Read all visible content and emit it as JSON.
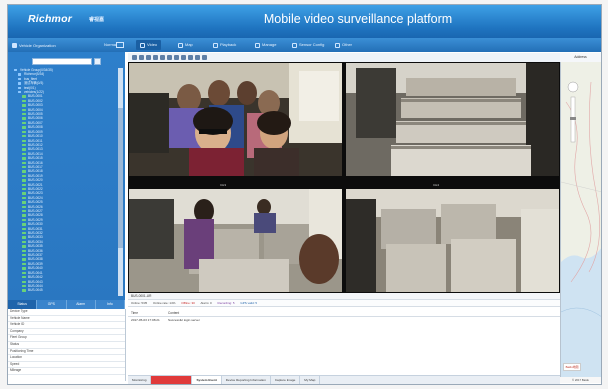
{
  "header": {
    "brand": "Richmor",
    "brand_suffix": "睿视嘉",
    "title": "Mobile video surveillance platform"
  },
  "toolbar": {
    "sidebar_label": "Vehicle Organization",
    "sidebar_mode": "Normal",
    "tabs": [
      {
        "label": "Video",
        "icon": "video-icon"
      },
      {
        "label": "Map",
        "icon": "map-icon"
      },
      {
        "label": "Playback",
        "icon": "playback-icon"
      },
      {
        "label": "Manage",
        "icon": "manage-icon"
      },
      {
        "label": "Sensor Config",
        "icon": "config-icon"
      },
      {
        "label": "Other",
        "icon": "other-icon"
      }
    ]
  },
  "sidebar": {
    "search": {
      "placeholder": "",
      "value": ""
    },
    "tree": {
      "root": "Vehicle Group(0/34/35)",
      "groups": [
        "Richmor(5/34)",
        "bus_fleet",
        "测试车辆(0/3)",
        "test(0/1)",
        "vehicles(1/22)"
      ],
      "vehicles": [
        "BUS-0001",
        "BUS-0002",
        "BUS-0003",
        "BUS-0004",
        "BUS-0005",
        "BUS-0006",
        "BUS-0007",
        "BUS-0008",
        "BUS-0009",
        "BUS-0010",
        "BUS-0011",
        "BUS-0012",
        "BUS-0013",
        "BUS-0014",
        "BUS-0015",
        "BUS-0016",
        "BUS-0017",
        "BUS-0018",
        "BUS-0019",
        "BUS-0020",
        "BUS-0021",
        "BUS-0022",
        "BUS-0023",
        "BUS-0024",
        "BUS-0025",
        "BUS-0026",
        "BUS-0027",
        "BUS-0028",
        "BUS-0029",
        "BUS-0030",
        "BUS-0031",
        "BUS-0032",
        "BUS-0033",
        "BUS-0034",
        "BUS-0035",
        "BUS-0036",
        "BUS-0037",
        "BUS-0038",
        "BUS-0039",
        "BUS-0040",
        "BUS-0041",
        "BUS-0042",
        "BUS-0043",
        "BUS-0044",
        "BUS-0045"
      ]
    },
    "lower_tabs": [
      "Status",
      "GPS",
      "Alarm",
      "Info"
    ],
    "info_rows": [
      "Device Type",
      "Vehicle Name",
      "Vehicle ID",
      "Company",
      "Fleet Group",
      "Status",
      "Positioning Time",
      "Location",
      "Speed",
      "Mileage"
    ]
  },
  "video": {
    "channels": [
      {
        "label": "CH1"
      },
      {
        "label": "CH2"
      },
      {
        "label": "CH3"
      },
      {
        "label": "CH4"
      }
    ],
    "mid_labels": [
      "CH3",
      "CH4"
    ]
  },
  "map": {
    "header": "Address",
    "footer": "© 2017 Baidu",
    "logo": "Baidu地图"
  },
  "status": {
    "title": "BUS-0001-UR",
    "stats": [
      {
        "label": "Online: 5/35",
        "color": "#2b8a2b"
      },
      {
        "label": "Online rate: 14%",
        "color": "#1a1a1a"
      },
      {
        "label": "Offline: 30",
        "color": "#c62828"
      },
      {
        "label": "Alarm: 0",
        "color": "#1a1a1a"
      },
      {
        "label": "Recording: 5",
        "color": "#7b3fa0"
      },
      {
        "label": "GPS valid: 5",
        "color": "#1f62a8"
      }
    ],
    "log_columns": [
      "Time",
      "Content"
    ],
    "log_rows": [
      {
        "time": "2017-05-03 17:08:21",
        "content": "Successful login server"
      }
    ],
    "bottom_tabs": [
      "Monitoring",
      "",
      "System Event",
      "Device Reporting Information",
      "Capture Image",
      "My Map"
    ]
  },
  "colors": {
    "titlebar": "#1f74c0",
    "sidebar": "#2d7fcb",
    "online": "#6ad27a",
    "alert_tab": "#e03a3a"
  }
}
